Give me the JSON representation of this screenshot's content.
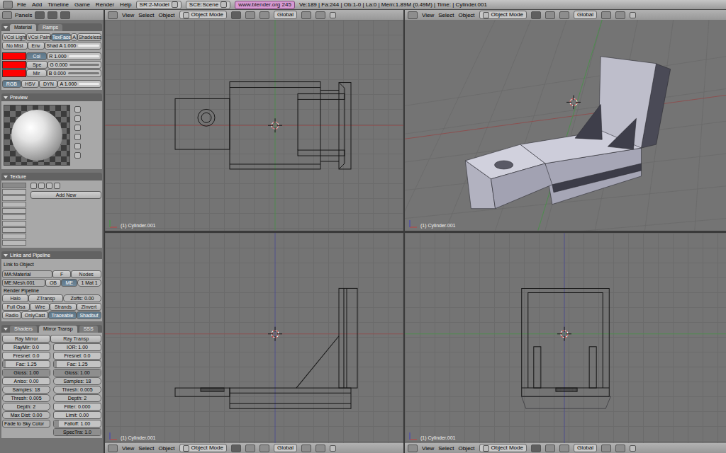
{
  "topbar": {
    "menus": [
      "File",
      "Add",
      "Timeline",
      "Game",
      "Render",
      "Help"
    ],
    "screen": "SR:2-Model",
    "scene": "SCE:Scene",
    "site": "www.blender.org 245",
    "stats": "Ve:189 | Fa:244 | Ob:1-0 | La:0 | Mem:1.89M (0.49M) | Time: | Cylinder.001"
  },
  "buttons_window": {
    "header": "Panels",
    "panels": [
      {
        "tabs": [
          {
            "label": "Material",
            "selected": true
          },
          {
            "label": "Ramps",
            "selected": false
          }
        ],
        "rows": [
          [
            {
              "kind": "toggle",
              "text": "VCol Light",
              "selected": false
            },
            {
              "kind": "toggle",
              "text": "VCol Paint",
              "selected": false
            },
            {
              "kind": "toggle",
              "text": "TexFace",
              "selected": true
            },
            {
              "kind": "toggle",
              "text": "A",
              "selected": false
            },
            {
              "kind": "toggle",
              "text": "Shadeless",
              "selected": false
            }
          ],
          [
            {
              "kind": "toggle",
              "text": "No Mist",
              "selected": false
            },
            {
              "kind": "toggle",
              "text": "Env",
              "selected": false
            },
            {
              "kind": "slider",
              "text": "Shad A 1.000",
              "level": 1
            }
          ],
          [
            {
              "kind": "swatch",
              "color": "#ff0000"
            },
            {
              "kind": "toggle",
              "text": "Col",
              "selected": true
            },
            {
              "kind": "slider",
              "text": "R 1.000",
              "level": 1
            }
          ],
          [
            {
              "kind": "swatch",
              "color": "#ff0000"
            },
            {
              "kind": "toggle",
              "text": "Spe",
              "selected": false
            },
            {
              "kind": "slider",
              "text": "G 0.000",
              "level": 0
            }
          ],
          [
            {
              "kind": "swatch",
              "color": "#ff0000"
            },
            {
              "kind": "toggle",
              "text": "Mir",
              "selected": false
            },
            {
              "kind": "slider",
              "text": "B 0.000",
              "level": 0
            }
          ],
          [
            {
              "kind": "toggle",
              "text": "RGB",
              "selected": true
            },
            {
              "kind": "toggle",
              "text": "HSV",
              "selected": false
            },
            {
              "kind": "toggle",
              "text": "DYN",
              "selected": false
            },
            {
              "kind": "slider",
              "text": "A 1.000",
              "level": 1
            }
          ]
        ]
      },
      {
        "title": "Preview",
        "rows": [
          [
            {
              "kind": "preview"
            }
          ]
        ]
      },
      {
        "title": "Texture",
        "rows": [
          [
            {
              "kind": "slots",
              "slots": [
                {
                  "selected": true
                },
                {
                  "selected": false
                },
                {
                  "selected": false
                },
                {
                  "selected": false
                },
                {
                  "selected": false
                },
                {
                  "selected": false
                },
                {
                  "selected": false
                },
                {
                  "selected": false
                },
                {
                  "selected": false
                },
                {
                  "selected": false
                }
              ]
            },
            {
              "kind": "stack",
              "items": [
                {
                  "kind": "button",
                  "text": "Add New"
                }
              ]
            }
          ]
        ]
      },
      {
        "title": "Links and Pipeline",
        "rows": [
          [
            {
              "kind": "label",
              "text": "Link to Object"
            }
          ],
          [
            {
              "kind": "menu",
              "text": "MA:Material"
            },
            {
              "kind": "button",
              "text": "F"
            },
            {
              "kind": "button",
              "text": "Nodes"
            }
          ],
          [
            {
              "kind": "menu",
              "text": "ME:Mesh.001"
            },
            {
              "kind": "toggle",
              "text": "OB",
              "selected": false
            },
            {
              "kind": "toggle",
              "text": "ME",
              "selected": true
            },
            {
              "kind": "field",
              "text": "1 Mat 1"
            }
          ],
          [
            {
              "kind": "label",
              "text": "Render Pipeline"
            }
          ],
          [
            {
              "kind": "toggle",
              "text": "Halo",
              "selected": false
            },
            {
              "kind": "toggle",
              "text": "ZTransp",
              "selected": false
            },
            {
              "kind": "field",
              "text": "Zoffs: 0.00"
            }
          ],
          [
            {
              "kind": "toggle",
              "text": "Full Osa",
              "selected": false
            },
            {
              "kind": "toggle",
              "text": "Wire",
              "selected": false
            },
            {
              "kind": "toggle",
              "text": "Strands",
              "selected": false
            },
            {
              "kind": "toggle",
              "text": "ZInvert",
              "selected": false
            }
          ],
          [
            {
              "kind": "toggle",
              "text": "Radio",
              "selected": false
            },
            {
              "kind": "toggle",
              "text": "OnlyCast",
              "selected": false
            },
            {
              "kind": "toggle",
              "text": "Traceable",
              "selected": true
            },
            {
              "kind": "toggle",
              "text": "Shadbuf",
              "selected": true
            }
          ]
        ]
      },
      {
        "tabs": [
          {
            "label": "Shaders",
            "selected": false
          },
          {
            "label": "Mirror Transp",
            "selected": true
          },
          {
            "label": "SSS",
            "selected": false
          }
        ],
        "rows": [
          [
            {
              "kind": "toggle",
              "text": "Ray Mirror",
              "selected": false
            },
            {
              "kind": "toggle",
              "text": "Ray Transp",
              "selected": false
            }
          ],
          [
            {
              "kind": "columns",
              "columns": [
                [
                  {
                    "kind": "numslider",
                    "text": "RayMir: 0.0",
                    "level": 0
                  },
                  {
                    "kind": "numslider",
                    "text": "Fresnel: 0.0",
                    "level": 0
                  },
                  {
                    "kind": "numslider",
                    "text": "Fac: 1.25",
                    "level": 0.06
                  },
                  {
                    "kind": "numslider",
                    "text": "Gloss: 1.00",
                    "level": 1
                  },
                  {
                    "kind": "numslider",
                    "text": "Aniso: 0.00",
                    "level": 0
                  },
                  {
                    "kind": "field",
                    "text": "Samples: 18"
                  },
                  {
                    "kind": "field",
                    "text": "Thresh: 0.005"
                  },
                  {
                    "kind": "field",
                    "text": "Depth: 2"
                  },
                  {
                    "kind": "field",
                    "text": "Max Dist: 0.00"
                  },
                  {
                    "kind": "menu",
                    "text": "Fade to Sky Color"
                  }
                ],
                [
                  {
                    "kind": "numslider",
                    "text": "IOR: 1.00",
                    "level": 0
                  },
                  {
                    "kind": "numslider",
                    "text": "Fresnel: 0.0",
                    "level": 0
                  },
                  {
                    "kind": "numslider",
                    "text": "Fac: 1.25",
                    "level": 0.06
                  },
                  {
                    "kind": "numslider",
                    "text": "Gloss: 1.00",
                    "level": 1
                  },
                  {
                    "kind": "field",
                    "text": "Samples: 18"
                  },
                  {
                    "kind": "field",
                    "text": "Thresh: 0.005"
                  },
                  {
                    "kind": "field",
                    "text": "Depth: 2"
                  },
                  {
                    "kind": "numslider",
                    "text": "Filter: 0.000",
                    "level": 0
                  },
                  {
                    "kind": "numslider",
                    "text": "Limit: 0.00",
                    "level": 0
                  },
                  {
                    "kind": "numslider",
                    "text": "Falloff: 1.00",
                    "level": 0.1
                  },
                  {
                    "kind": "numslider",
                    "text": "SpecTra: 1.0",
                    "level": 1
                  }
                ]
              ]
            }
          ]
        ]
      }
    ]
  },
  "viewports": [
    {
      "kind": "top",
      "label": "(1) Cylinder.001",
      "header": {
        "menus": [
          "View",
          "Select",
          "Object"
        ],
        "mode": "Object Mode",
        "orientation": "Global"
      }
    },
    {
      "kind": "perspective",
      "label": "(1) Cylinder.001",
      "header": {
        "menus": [
          "View",
          "Select",
          "Object"
        ],
        "mode": "Object Mode",
        "orientation": "Global"
      }
    },
    {
      "kind": "front",
      "label": "(1) Cylinder.001",
      "header": {
        "menus": [
          "View",
          "Select",
          "Object"
        ],
        "mode": "Object Mode",
        "orientation": "Global"
      }
    },
    {
      "kind": "side",
      "label": "(1) Cylinder.001",
      "header": {
        "menus": [
          "View",
          "Select",
          "Object"
        ],
        "mode": "Object Mode",
        "orientation": "Global"
      }
    }
  ]
}
